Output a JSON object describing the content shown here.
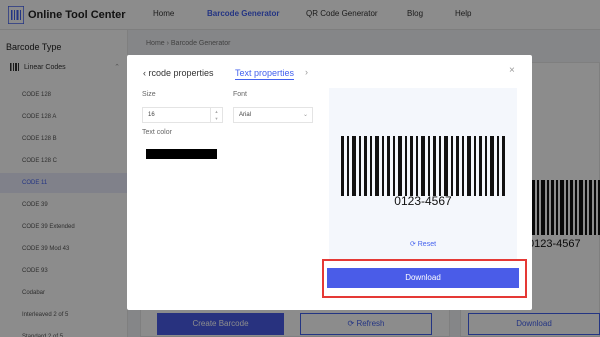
{
  "app": {
    "name": "Online Tool Center"
  },
  "nav": [
    "Home",
    "Barcode Generator",
    "QR Code Generator",
    "Blog",
    "Help"
  ],
  "nav_active": "Barcode Generator",
  "sidebar": {
    "title": "Barcode Type",
    "group": "Linear Codes",
    "items": [
      "CODE 128",
      "CODE 128 A",
      "CODE 128 B",
      "CODE 128 C",
      "CODE 11",
      "CODE 39",
      "CODE 39 Extended",
      "CODE 39 Mod 43",
      "CODE 93",
      "Codabar",
      "Interleaved 2 of 5",
      "Standard 2 of 5"
    ],
    "active": "CODE 11"
  },
  "breadcrumb": "Home › Barcode Generator",
  "background": {
    "create_label": "Create Barcode",
    "refresh_label": "Refresh",
    "download_label": "Download",
    "preview_code": "0123-4567"
  },
  "modal": {
    "tab_prev": "rcode properties",
    "tab_active": "Text properties",
    "size_label": "Size",
    "size_value": "16",
    "font_label": "Font",
    "font_value": "Arial",
    "text_color_label": "Text color",
    "text_color": "#000000",
    "preview_code": "0123-4567",
    "reset_label": "Reset",
    "download_label": "Download"
  },
  "colors": {
    "accent": "#4361ee",
    "highlight": "#e53935"
  }
}
